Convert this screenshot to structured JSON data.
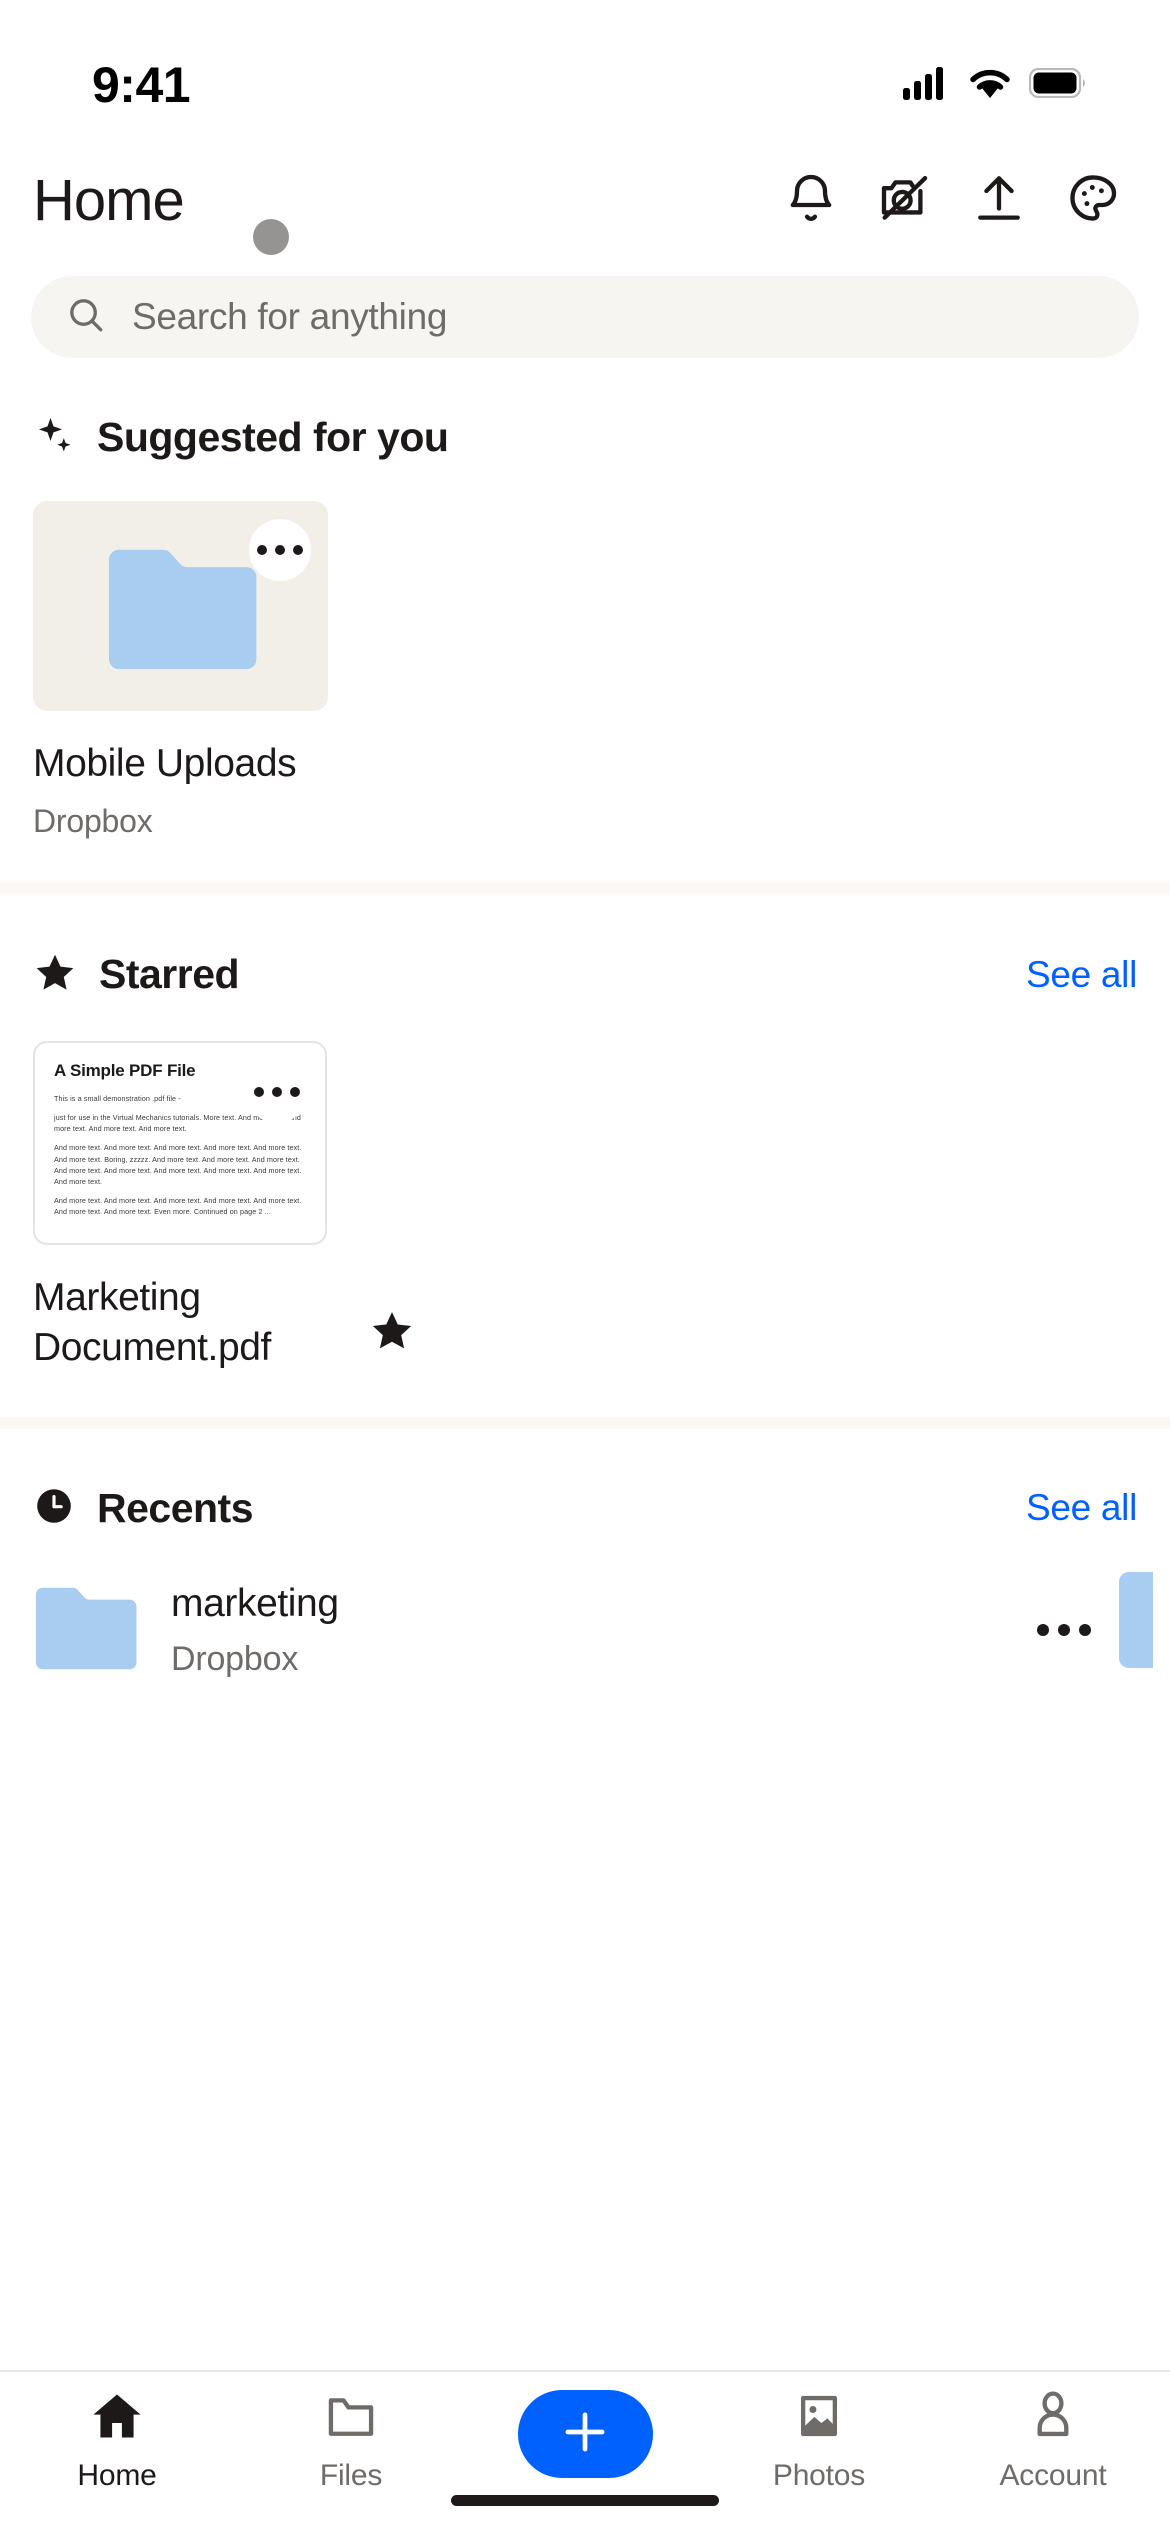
{
  "status_bar": {
    "time": "9:41",
    "cellular_icon": "cellular-signal-icon",
    "wifi_icon": "wifi-icon",
    "battery_icon": "battery-icon"
  },
  "header": {
    "title": "Home",
    "actions": [
      {
        "name": "notifications-icon",
        "label": "Notifications"
      },
      {
        "name": "camera-upload-off-icon",
        "label": "Camera uploads off"
      },
      {
        "name": "upload-icon",
        "label": "Upload"
      },
      {
        "name": "palette-icon",
        "label": "Theme"
      }
    ]
  },
  "search": {
    "placeholder": "Search for anything",
    "value": "",
    "icon": "search-icon"
  },
  "sections": {
    "suggested": {
      "icon": "sparkle-icon",
      "title": "Suggested for you",
      "items": [
        {
          "name": "Mobile Uploads",
          "source": "Dropbox",
          "thumb_type": "folder",
          "card_bg": "#f2efe9",
          "folder_color": "#a8cdf0",
          "menu_icon": "overflow-menu-icon"
        }
      ]
    },
    "starred": {
      "icon": "star-icon",
      "title": "Starred",
      "see_all": "See all",
      "items": [
        {
          "name": "Marketing Document.pdf",
          "starred": true,
          "star_icon": "star-filled-icon",
          "menu_icon": "overflow-menu-icon",
          "preview": {
            "title": "A Simple PDF File",
            "paragraphs": [
              "This is a small demonstration .pdf file -",
              "just for use in the Virtual Mechanics tutorials. More text. And more text. And more text. And more text. And more text.",
              "And more text. And more text. And more text. And more text. And more text. And more text. Boring, zzzzz. And more text. And more text. And more text. And more text. And more text. And more text. And more text. And more text. And more text.",
              "And more text. And more text. And more text. And more text. And more text. And more text. And more text. Even more. Continued on page 2 ..."
            ]
          }
        }
      ]
    },
    "recents": {
      "icon": "clock-icon",
      "title": "Recents",
      "see_all": "See all",
      "items": [
        {
          "name": "marketing",
          "source": "Dropbox",
          "thumb_type": "folder",
          "folder_color": "#a8cdf0",
          "menu_icon": "overflow-menu-icon"
        }
      ]
    }
  },
  "tab_bar": {
    "accent_color": "#0061ff",
    "tabs": [
      {
        "label": "Home",
        "icon": "home-icon",
        "active": true
      },
      {
        "label": "Files",
        "icon": "folder-icon",
        "active": false
      },
      {
        "label": "",
        "icon": "plus-icon",
        "active": false,
        "is_fab": true
      },
      {
        "label": "Photos",
        "icon": "photos-icon",
        "active": false
      },
      {
        "label": "Account",
        "icon": "person-icon",
        "active": false
      }
    ]
  }
}
